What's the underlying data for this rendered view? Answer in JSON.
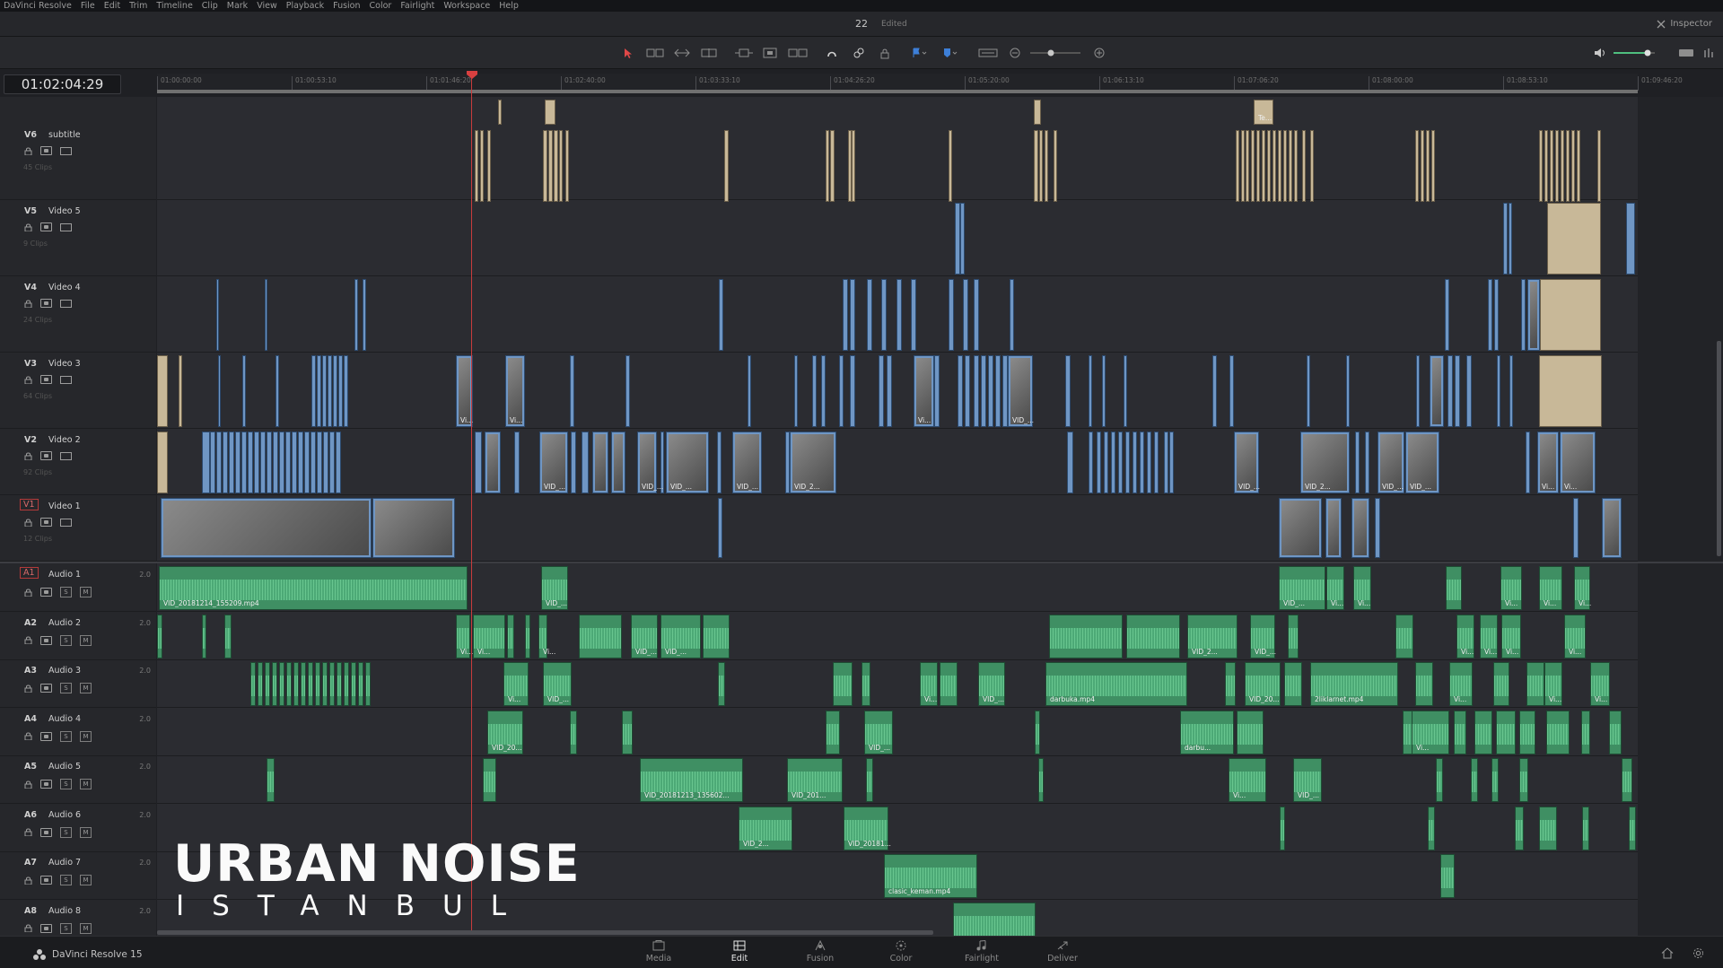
{
  "menu": [
    "DaVinci Resolve",
    "File",
    "Edit",
    "Trim",
    "Timeline",
    "Clip",
    "Mark",
    "View",
    "Playback",
    "Fusion",
    "Color",
    "Fairlight",
    "Workspace",
    "Help"
  ],
  "project": {
    "name": "22",
    "status": "Edited",
    "inspector_label": "Inspector"
  },
  "timecode": "01:02:04:29",
  "ruler_ticks": [
    "01:00:00:00",
    "01:00:53:10",
    "01:01:46:20",
    "01:02:40:00",
    "01:03:33:10",
    "01:04:26:20",
    "01:05:20:00",
    "01:06:13:10",
    "01:07:06:20",
    "01:08:00:00",
    "01:08:53:10",
    "01:09:46:20"
  ],
  "video_tracks": [
    {
      "id": "V6",
      "name": "subtitle",
      "count": "45 Clips"
    },
    {
      "id": "V5",
      "name": "Video 5",
      "count": "9 Clips"
    },
    {
      "id": "V4",
      "name": "Video 4",
      "count": "24 Clips"
    },
    {
      "id": "V3",
      "name": "Video 3",
      "count": "64 Clips"
    },
    {
      "id": "V2",
      "name": "Video 2",
      "count": "92 Clips"
    },
    {
      "id": "V1",
      "name": "Video 1",
      "count": "12 Clips"
    }
  ],
  "audio_tracks": [
    {
      "id": "A1",
      "name": "Audio 1",
      "ch": "2.0"
    },
    {
      "id": "A2",
      "name": "Audio 2",
      "ch": "2.0"
    },
    {
      "id": "A3",
      "name": "Audio 3",
      "ch": "2.0"
    },
    {
      "id": "A4",
      "name": "Audio 4",
      "ch": "2.0"
    },
    {
      "id": "A5",
      "name": "Audio 5",
      "ch": "2.0"
    },
    {
      "id": "A6",
      "name": "Audio 6",
      "ch": "2.0"
    },
    {
      "id": "A7",
      "name": "Audio 7",
      "ch": "2.0"
    },
    {
      "id": "A8",
      "name": "Audio 8",
      "ch": "2.0"
    }
  ],
  "solo_label": "S",
  "mute_label": "M",
  "clip_labels": {
    "a1_main": "VID_20181214_155209.mp4",
    "vid_short": "VID_...",
    "vi": "Vi...",
    "vid_2": "VID_2...",
    "vid_20": "VID_20...",
    "darbuka": "darbuka.mp4",
    "darbu": "darbu...",
    "klarnet": "2liklarnet.mp4",
    "a5_long": "VID_20181213_135602...",
    "vid_201": "VID_201...",
    "vid_20181": "VID_20181...",
    "keman": "clasic_keman.mp4",
    "te": "Te..."
  },
  "overlay": {
    "title": "URBAN NOISE",
    "subtitle": "ISTANBUL"
  },
  "app_name": "DaVinci Resolve 15",
  "pages": [
    "Media",
    "Edit",
    "Fusion",
    "Color",
    "Fairlight",
    "Deliver"
  ],
  "active_page": "Edit",
  "colors": {
    "accent": "#c83c3c",
    "subtitle_clip": "#c8b898",
    "video_clip": "#6f96c4",
    "audio_clip": "#3f8f63"
  }
}
